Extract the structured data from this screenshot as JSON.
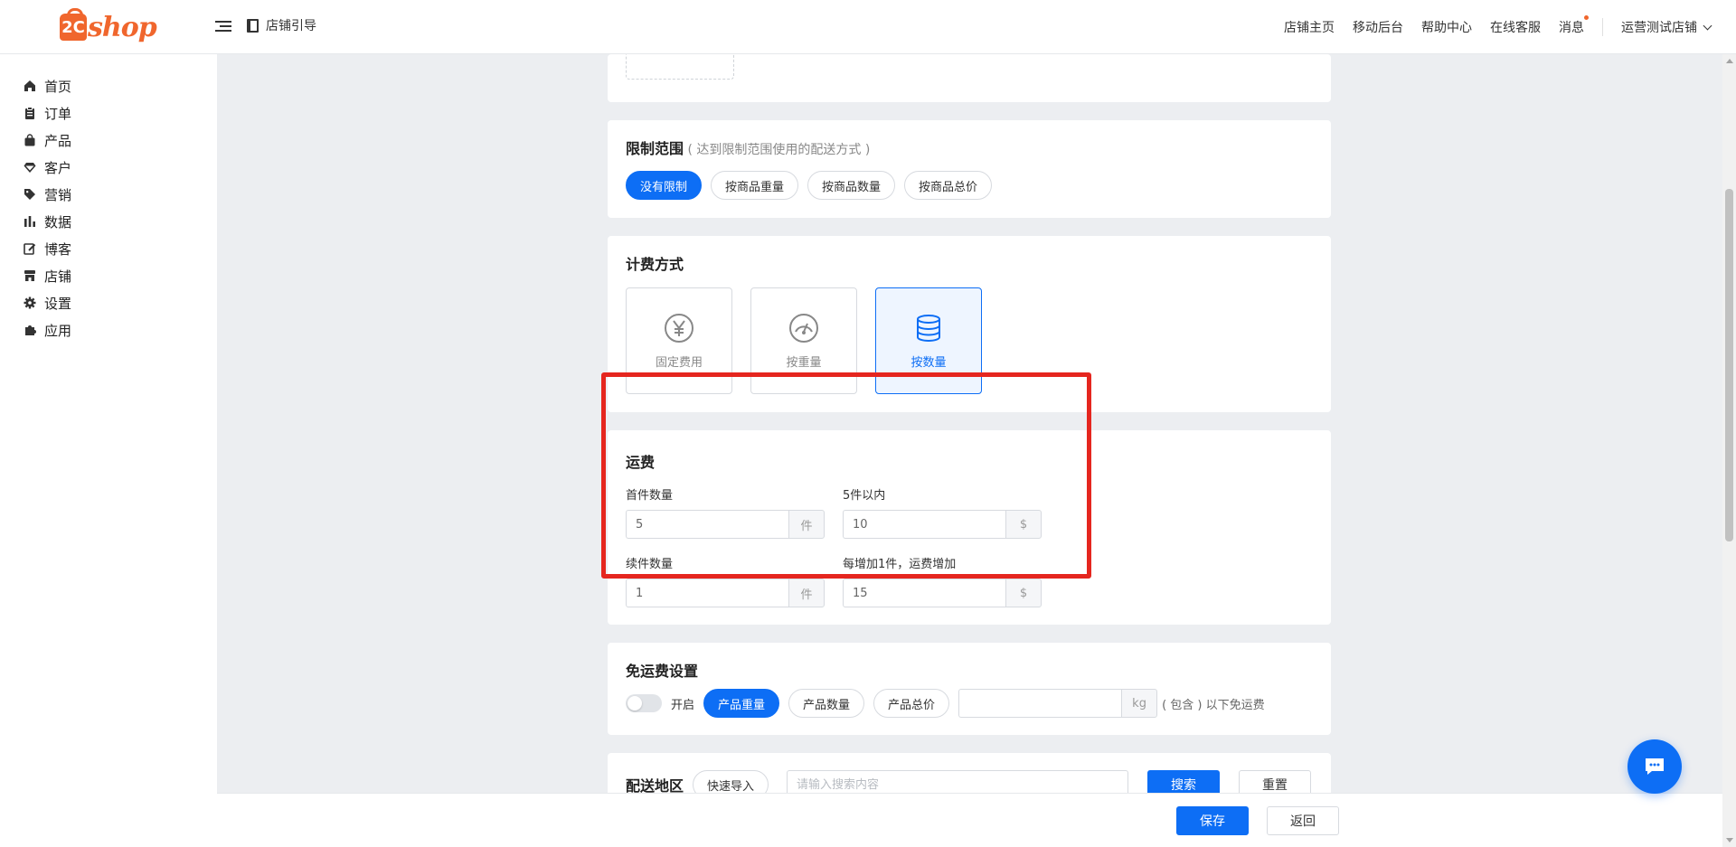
{
  "brand": {
    "logo_badge": "2C",
    "logo_text": "shop",
    "color": "#f0662d"
  },
  "header": {
    "guide_label": "店铺引导",
    "nav": [
      "店铺主页",
      "移动后台",
      "帮助中心",
      "在线客服",
      "消息"
    ],
    "store_name": "运营测试店铺"
  },
  "sidebar": {
    "items": [
      {
        "label": "首页",
        "icon": "home-icon"
      },
      {
        "label": "订单",
        "icon": "clipboard-icon"
      },
      {
        "label": "产品",
        "icon": "bag-icon"
      },
      {
        "label": "客户",
        "icon": "diamond-icon"
      },
      {
        "label": "营销",
        "icon": "tag-icon"
      },
      {
        "label": "数据",
        "icon": "bar-chart-icon"
      },
      {
        "label": "博客",
        "icon": "edit-icon"
      },
      {
        "label": "店铺",
        "icon": "store-icon"
      },
      {
        "label": "设置",
        "icon": "gear-icon"
      },
      {
        "label": "应用",
        "icon": "puzzle-icon"
      }
    ]
  },
  "range": {
    "title": "限制范围",
    "hint": "( 达到限制范围使用的配送方式 )",
    "options": [
      "没有限制",
      "按商品重量",
      "按商品数量",
      "按商品总价"
    ],
    "selected": "没有限制"
  },
  "billing": {
    "title": "计费方式",
    "methods": [
      {
        "label": "固定费用",
        "icon": "yen-icon"
      },
      {
        "label": "按重量",
        "icon": "gauge-icon"
      },
      {
        "label": "按数量",
        "icon": "database-icon"
      }
    ],
    "selected": "按数量"
  },
  "freight": {
    "title": "运费",
    "first_qty": {
      "label": "首件数量",
      "value": "5",
      "unit": "件"
    },
    "first_fee": {
      "label": "5件以内",
      "value": "10",
      "unit": "$"
    },
    "extra_qty": {
      "label": "续件数量",
      "value": "1",
      "unit": "件"
    },
    "extra_fee": {
      "label": "每增加1件，运费增加",
      "value": "15",
      "unit": "$"
    }
  },
  "free_shipping": {
    "title": "免运费设置",
    "toggle_label": "开启",
    "options": [
      "产品重量",
      "产品数量",
      "产品总价"
    ],
    "selected": "产品重量",
    "threshold_value": "",
    "unit": "kg",
    "suffix": "( 包含 ) 以下免运费"
  },
  "delivery_area": {
    "title": "配送地区",
    "import_label": "快速导入",
    "search_placeholder": "请输入搜索内容",
    "search_label": "搜索",
    "reset_label": "重置"
  },
  "footer": {
    "save_label": "保存",
    "back_label": "返回"
  },
  "colors": {
    "accent": "#0d6ef5",
    "highlight": "#e5261f"
  }
}
